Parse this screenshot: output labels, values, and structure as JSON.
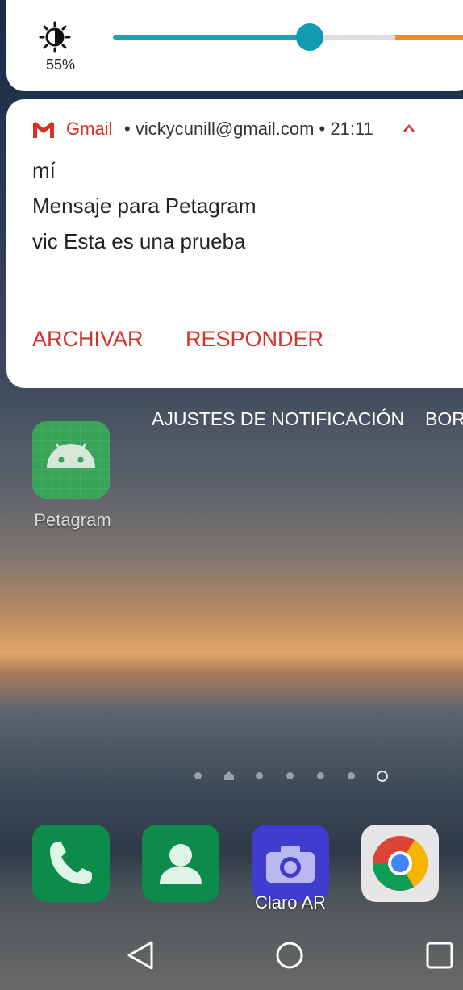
{
  "brightness": {
    "value_text": "55%",
    "level_percent": 55,
    "icon": "brightness-icon",
    "track_color": "#1aa1b3",
    "warning_color": "#f08a24"
  },
  "notification": {
    "app_name": "Gmail",
    "account": "vickycunill@gmail.com",
    "time": "21:11",
    "header_meta": "• vickycunill@gmail.com • 21:11",
    "sender": "mí",
    "subject": "Mensaje para Petagram",
    "body": "vic Esta es una prueba",
    "actions": {
      "archive": "ARCHIVAR",
      "reply": "RESPONDER"
    },
    "accent_color": "#d93025",
    "icons": [
      "gmail-icon",
      "chevron-up-icon"
    ]
  },
  "notification_footer": {
    "settings_label": "AJUSTES DE NOTIFICACIÓN",
    "clear_label": "BOR"
  },
  "home": {
    "apps": [
      {
        "label": "Petagram",
        "icon": "android-app-icon"
      }
    ]
  },
  "dock": {
    "apps": [
      {
        "name": "phone",
        "icon": "phone-icon"
      },
      {
        "name": "contacts",
        "icon": "contacts-icon"
      },
      {
        "name": "camera",
        "icon": "camera-icon",
        "label": "Claro AR"
      },
      {
        "name": "chrome",
        "icon": "chrome-icon"
      }
    ]
  },
  "nav_bar": {
    "icons": [
      "back-icon",
      "home-icon",
      "recents-icon"
    ]
  }
}
